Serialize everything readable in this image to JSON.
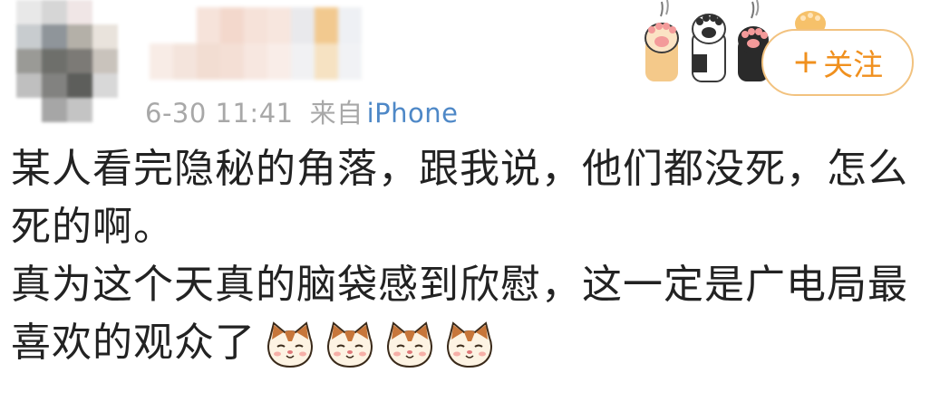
{
  "post": {
    "timestamp": "6-30 11:41",
    "source_prefix": "来自",
    "source_device": "iPhone"
  },
  "follow_button": {
    "label": "关注",
    "icon": "plus-icon",
    "color": "#f0901e",
    "border_color": "#f2c27f"
  },
  "content": {
    "paragraph_1": "某人看完隐秘的角落，跟我说，他们都没死，怎么死的啊。",
    "paragraph_2": "真为这个天真的脑袋感到欣慰，这一定是广电局最喜欢的观众了",
    "emojis": [
      "cat-face-icon",
      "cat-face-icon",
      "cat-face-icon",
      "cat-face-icon"
    ]
  },
  "colors": {
    "text": "#222222",
    "meta": "#a8a8a8",
    "link": "#4e88c7"
  }
}
